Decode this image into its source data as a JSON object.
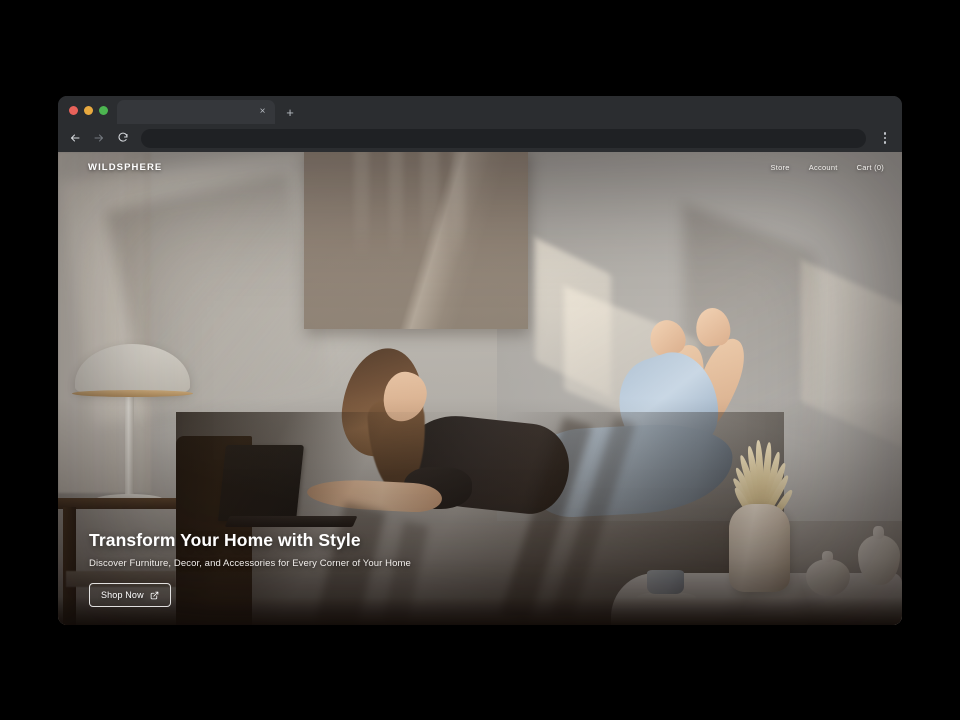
{
  "browser": {
    "traffic_lights": [
      "close",
      "minimize",
      "zoom"
    ],
    "tab": {
      "title": "",
      "close_label": "×"
    },
    "new_tab_label": "+",
    "toolbar": {
      "back_icon": "arrow-left-icon",
      "forward_icon": "arrow-right-icon",
      "reload_icon": "reload-icon",
      "address_value": "",
      "address_placeholder": "",
      "menu_icon": "kebab-menu-icon"
    }
  },
  "site": {
    "brand": "WILDSPHERE",
    "nav": [
      {
        "label": "Store"
      },
      {
        "label": "Account"
      },
      {
        "label": "Cart (0)"
      }
    ],
    "hero": {
      "title": "Transform Your Home with Style",
      "subtitle": "Discover Furniture, Decor, and Accessories for Every Corner of Your Home",
      "cta_label": "Shop Now",
      "cta_icon": "external-link-icon"
    }
  },
  "scene": {
    "description": "Sunlit living room: woman lying on a tan sofa using a laptop, dome table lamp at left, large taupe art panel on the wall, marble side table with ceramic vases, pampas grass and a coffee cup at right",
    "colors": {
      "wall": "#b3b0ab",
      "art_panel": "#8e8175",
      "sofa": "#b07c51",
      "sofa_shadow": "#3a2a1d",
      "jeans": "#bcd0e2",
      "shirt": "#2a2422",
      "skin": "#e6c2a3",
      "vase": "#e4dfd6",
      "pampas": "#ddc999",
      "marble": "#eceae6",
      "background": "#000000",
      "chrome": "#2b2d30",
      "omnibox": "#1f2124"
    }
  }
}
